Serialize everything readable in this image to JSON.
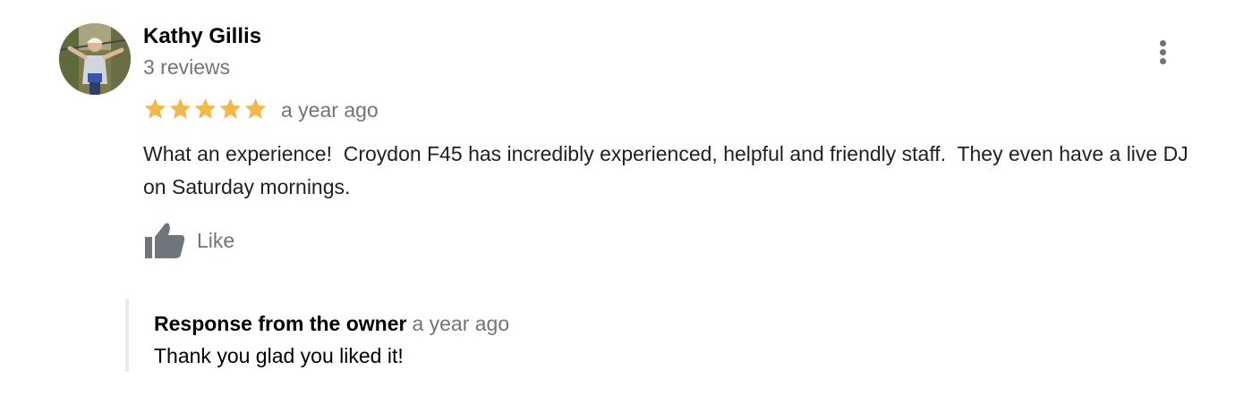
{
  "review": {
    "author_name": "Kathy Gillis",
    "review_count": "3 reviews",
    "rating": 5,
    "max_rating": 5,
    "date": "a year ago",
    "text": "What an experience!  Croydon F45 has incredibly experienced, helpful and friendly staff.  They even have a live DJ on Saturday mornings.",
    "like_label": "Like",
    "avatar_icon": "profile-photo",
    "more_icon": "more-vert-icon",
    "like_icon": "thumbs-up-icon"
  },
  "owner_response": {
    "title": "Response from the owner",
    "date": "a year ago",
    "text": "Thank you glad you liked it!"
  },
  "colors": {
    "star": "#f2b84b",
    "secondary_text": "#70757a",
    "primary_text": "#202124",
    "like_icon": "#70757a",
    "response_border": "#e8eaed"
  }
}
